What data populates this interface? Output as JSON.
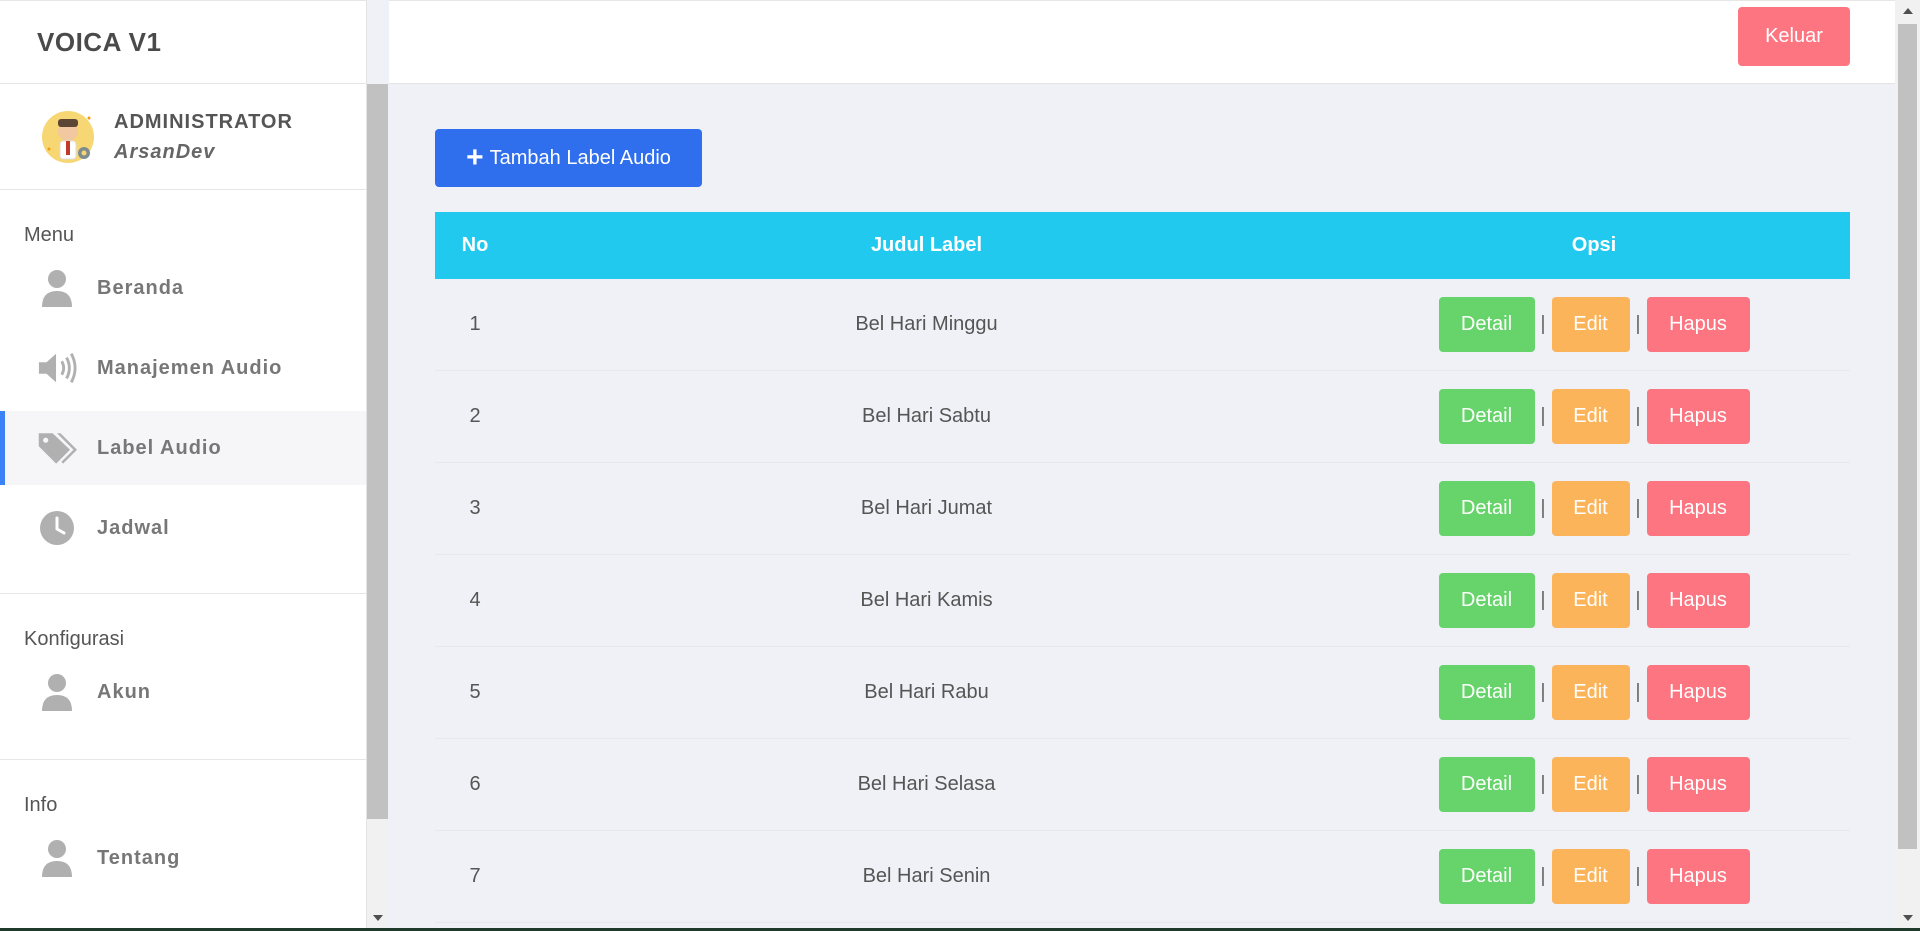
{
  "app": {
    "brand": "VOICA V1"
  },
  "topbar": {
    "logout_label": "Keluar"
  },
  "profile": {
    "role": "ADMINISTRATOR",
    "username": "ArsanDev"
  },
  "sidebar": {
    "sections": [
      {
        "title": "Menu"
      },
      {
        "title": "Konfigurasi"
      },
      {
        "title": "Info"
      }
    ],
    "items": [
      {
        "label": "Beranda",
        "icon": "user-icon"
      },
      {
        "label": "Manajemen Audio",
        "icon": "speaker-icon"
      },
      {
        "label": "Label Audio",
        "icon": "tags-icon",
        "active": true
      },
      {
        "label": "Jadwal",
        "icon": "clock-icon"
      },
      {
        "label": "Akun",
        "icon": "user-icon"
      },
      {
        "label": "Tentang",
        "icon": "user-icon"
      }
    ]
  },
  "main": {
    "add_label": "Tambah Label Audio",
    "table": {
      "headers": {
        "no": "No",
        "title": "Judul Label",
        "ops": "Opsi"
      },
      "actions": {
        "detail": "Detail",
        "edit": "Edit",
        "delete": "Hapus",
        "separator": "|"
      },
      "rows": [
        {
          "no": "1",
          "title": "Bel Hari Minggu"
        },
        {
          "no": "2",
          "title": "Bel Hari Sabtu"
        },
        {
          "no": "3",
          "title": "Bel Hari Jumat"
        },
        {
          "no": "4",
          "title": "Bel Hari Kamis"
        },
        {
          "no": "5",
          "title": "Bel Hari Rabu"
        },
        {
          "no": "6",
          "title": "Bel Hari Selasa"
        },
        {
          "no": "7",
          "title": "Bel Hari Senin"
        }
      ]
    }
  },
  "colors": {
    "primary": "#2f6fee",
    "table_header": "#22c9ee",
    "detail": "#66d46a",
    "edit": "#fbb45a",
    "delete": "#fc7580",
    "active_indicator": "#3b82f6"
  }
}
